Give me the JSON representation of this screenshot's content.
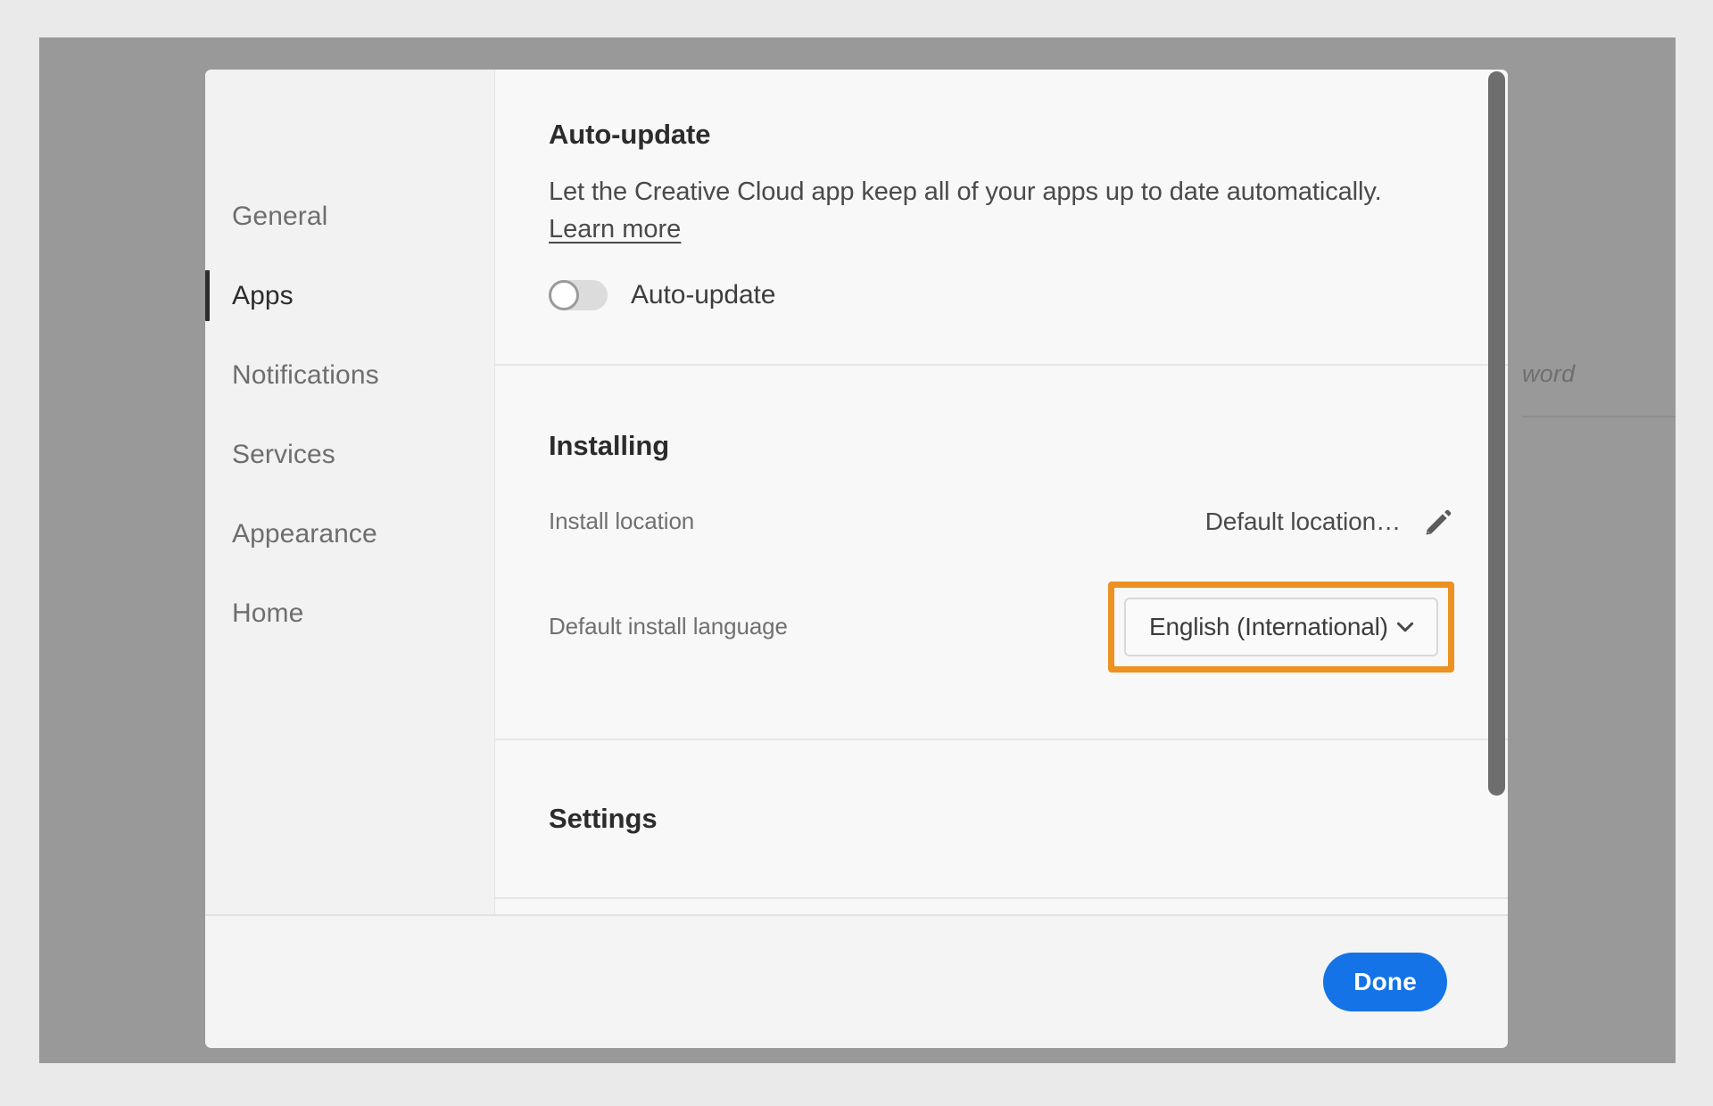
{
  "window": {
    "backdrop_text": "word"
  },
  "dialog": {
    "sidebar": {
      "items": [
        {
          "label": "General",
          "selected": false
        },
        {
          "label": "Apps",
          "selected": true
        },
        {
          "label": "Notifications",
          "selected": false
        },
        {
          "label": "Services",
          "selected": false
        },
        {
          "label": "Appearance",
          "selected": false
        },
        {
          "label": "Home",
          "selected": false
        }
      ]
    },
    "sections": {
      "auto_update": {
        "title": "Auto-update",
        "description": "Let the Creative Cloud app keep all of your apps up to date automatically.",
        "learn_more": "Learn more",
        "toggle_label": "Auto-update",
        "toggle_state": "off"
      },
      "installing": {
        "title": "Installing",
        "install_location_label": "Install location",
        "install_location_value": "Default location…",
        "edit_icon": "pencil-icon",
        "language_label": "Default install language",
        "language_value": "English (International)",
        "language_options": [
          "English (International)"
        ],
        "chevron_icon": "chevron-down-icon"
      },
      "settings": {
        "title": "Settings"
      }
    },
    "footer": {
      "done_label": "Done"
    }
  },
  "annotation": {
    "highlight_color": "#ED9121",
    "target": "default-install-language-dropdown"
  },
  "colors": {
    "accent_blue": "#1473E6",
    "highlight_orange": "#ED9121",
    "page_background": "#EAEAEA",
    "backdrop_overlay": "#999999",
    "dialog_background": "#F8F8F8",
    "sidebar_background": "#F2F2F2",
    "scrollbar_thumb": "#6E6E6E"
  }
}
